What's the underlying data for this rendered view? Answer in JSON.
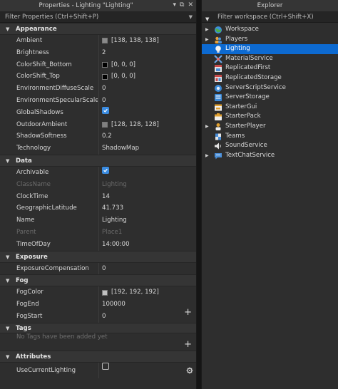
{
  "properties": {
    "title": "Properties - Lighting \"Lighting\"",
    "filter_placeholder": "Filter Properties (Ctrl+Shift+P)",
    "sections": {
      "appearance": {
        "label": "Appearance",
        "rows": [
          {
            "name": "Ambient",
            "value": "[138, 138, 138]",
            "swatch": "#8a8a8a"
          },
          {
            "name": "Brightness",
            "value": "2"
          },
          {
            "name": "ColorShift_Bottom",
            "value": "[0, 0, 0]",
            "swatch": "#000000"
          },
          {
            "name": "ColorShift_Top",
            "value": "[0, 0, 0]",
            "swatch": "#000000"
          },
          {
            "name": "EnvironmentDiffuseScale",
            "value": "0"
          },
          {
            "name": "EnvironmentSpecularScale",
            "value": "0"
          },
          {
            "name": "GlobalShadows",
            "checked": true
          },
          {
            "name": "OutdoorAmbient",
            "value": "[128, 128, 128]",
            "swatch": "#808080"
          },
          {
            "name": "ShadowSoftness",
            "value": "0.2"
          },
          {
            "name": "Technology",
            "value": "ShadowMap"
          }
        ]
      },
      "data": {
        "label": "Data",
        "rows": [
          {
            "name": "Archivable",
            "checked": true
          },
          {
            "name": "ClassName",
            "value": "Lighting"
          },
          {
            "name": "ClockTime",
            "value": "14"
          },
          {
            "name": "GeographicLatitude",
            "value": "41.733"
          },
          {
            "name": "Name",
            "value": "Lighting"
          },
          {
            "name": "Parent",
            "value": "Place1"
          },
          {
            "name": "TimeOfDay",
            "value": "14:00:00"
          }
        ]
      },
      "exposure": {
        "label": "Exposure",
        "rows": [
          {
            "name": "ExposureCompensation",
            "value": "0"
          }
        ]
      },
      "fog": {
        "label": "Fog",
        "rows": [
          {
            "name": "FogColor",
            "value": "[192, 192, 192]",
            "swatch": "#c0c0c0"
          },
          {
            "name": "FogEnd",
            "value": "100000"
          },
          {
            "name": "FogStart",
            "value": "0"
          }
        ]
      },
      "tags": {
        "label": "Tags",
        "empty_note": "No Tags have been added yet"
      },
      "attributes": {
        "label": "Attributes",
        "rows": [
          {
            "name": "UseCurrentLighting",
            "checked": false
          }
        ]
      }
    }
  },
  "explorer": {
    "title": "Explorer",
    "filter_placeholder": "Filter workspace (Ctrl+Shift+X)",
    "items": [
      {
        "label": "Workspace",
        "icon": "workspace-icon"
      },
      {
        "label": "Players",
        "icon": "players-icon"
      },
      {
        "label": "Lighting",
        "icon": "lighting-icon"
      },
      {
        "label": "MaterialService",
        "icon": "material-service-icon"
      },
      {
        "label": "ReplicatedFirst",
        "icon": "replicated-first-icon"
      },
      {
        "label": "ReplicatedStorage",
        "icon": "replicated-storage-icon"
      },
      {
        "label": "ServerScriptService",
        "icon": "server-script-service-icon"
      },
      {
        "label": "ServerStorage",
        "icon": "server-storage-icon"
      },
      {
        "label": "StarterGui",
        "icon": "starter-gui-icon"
      },
      {
        "label": "StarterPack",
        "icon": "starter-pack-icon"
      },
      {
        "label": "StarterPlayer",
        "icon": "starter-player-icon"
      },
      {
        "label": "Teams",
        "icon": "teams-icon"
      },
      {
        "label": "SoundService",
        "icon": "sound-service-icon"
      },
      {
        "label": "TextChatService",
        "icon": "text-chat-service-icon"
      }
    ]
  },
  "colors": {
    "selection": "#0d6ad1",
    "checkbox": "#3a8be0"
  }
}
